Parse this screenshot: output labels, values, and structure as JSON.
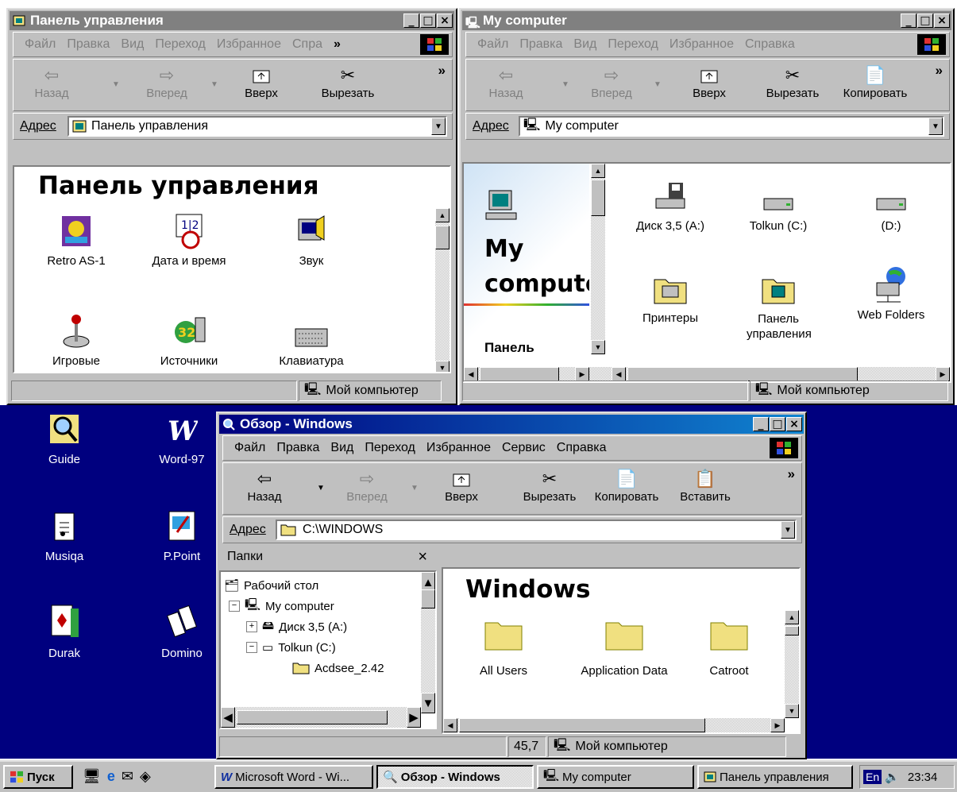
{
  "colors": {
    "desktop": "#00007f",
    "titlebar_active": "#00007f",
    "titlebar_inactive": "#808080",
    "window_face": "#c0c0c0",
    "folder": "#f0e080"
  },
  "control_panel_window": {
    "title": "Панель управления",
    "menu": [
      "Файл",
      "Правка",
      "Вид",
      "Переход",
      "Избранное",
      "Спра"
    ],
    "more": "»",
    "toolbar": {
      "back": "Назад",
      "forward": "Вперед",
      "up": "Вверх",
      "cut": "Вырезать"
    },
    "address_label": "Адрес",
    "address_value": "Панель управления",
    "heading": "Панель управления",
    "icons": [
      {
        "label": "Retro AS-1",
        "icon": "retro-icon"
      },
      {
        "label": "Дата и время",
        "icon": "calendar-clock-icon"
      },
      {
        "label": "Звук",
        "icon": "speaker-icon"
      },
      {
        "label": "Игровые",
        "icon": "joystick-icon"
      },
      {
        "label": "Источники данных",
        "icon": "data-sources-icon"
      },
      {
        "label": "Клавиатура",
        "icon": "keyboard-icon"
      }
    ],
    "status": "Мой компьютер"
  },
  "my_computer_window": {
    "title": "My computer",
    "menu": [
      "Файл",
      "Правка",
      "Вид",
      "Переход",
      "Избранное",
      "Справка"
    ],
    "more": "»",
    "toolbar": {
      "back": "Назад",
      "forward": "Вперед",
      "up": "Вверх",
      "cut": "Вырезать",
      "copy": "Копировать"
    },
    "address_label": "Адрес",
    "address_value": "My computer",
    "side_title_1": "My",
    "side_title_2": "computer",
    "side_sub": "Панель",
    "icons": [
      {
        "label": "Диск 3,5 (A:)",
        "icon": "floppy-drive-icon"
      },
      {
        "label": "Tolkun (C:)",
        "icon": "hard-drive-icon"
      },
      {
        "label": "(D:)",
        "icon": "hard-drive-icon"
      },
      {
        "label": "Принтеры",
        "icon": "printers-folder-icon"
      },
      {
        "label": "Панель управления",
        "icon": "control-panel-folder-icon"
      },
      {
        "label": "Web Folders",
        "icon": "web-folders-icon"
      }
    ],
    "status": "Мой компьютер"
  },
  "explorer_window": {
    "title": "Обзор - Windows",
    "menu": [
      "Файл",
      "Правка",
      "Вид",
      "Переход",
      "Избранное",
      "Сервис",
      "Справка"
    ],
    "more": "»",
    "toolbar": {
      "back": "Назад",
      "forward": "Вперед",
      "up": "Вверх",
      "cut": "Вырезать",
      "copy": "Копировать",
      "paste": "Вставить"
    },
    "address_label": "Адрес",
    "address_value": "C:\\WINDOWS",
    "folders_pane_title": "Папки",
    "folders_close": "×",
    "tree": [
      {
        "label": "Рабочий стол",
        "indent": 0,
        "expander": ""
      },
      {
        "label": "My computer",
        "indent": 1,
        "expander": "−"
      },
      {
        "label": "Диск 3,5 (A:)",
        "indent": 2,
        "expander": "+"
      },
      {
        "label": "Tolkun (C:)",
        "indent": 2,
        "expander": "−"
      },
      {
        "label": "Acdsee_2.42",
        "indent": 3,
        "expander": ""
      }
    ],
    "heading": "Windows",
    "folders": [
      "All Users",
      "Application Data",
      "Catroot"
    ],
    "status_size": "45,7",
    "status": "Мой компьютер"
  },
  "desktop_icons": [
    {
      "label": "Guide",
      "icon": "guide-icon"
    },
    {
      "label": "Word-97",
      "icon": "word-icon"
    },
    {
      "label": "Musiqa",
      "icon": "music-icon"
    },
    {
      "label": "P.Point",
      "icon": "powerpoint-icon"
    },
    {
      "label": "Durak",
      "icon": "cards-icon"
    },
    {
      "label": "Domino",
      "icon": "domino-icon"
    }
  ],
  "taskbar": {
    "start": "Пуск",
    "tasks": [
      "Microsoft Word - Wi...",
      "Обзор - Windows",
      "My computer",
      "Панель управления"
    ],
    "lang": "En",
    "time": "23:34"
  }
}
